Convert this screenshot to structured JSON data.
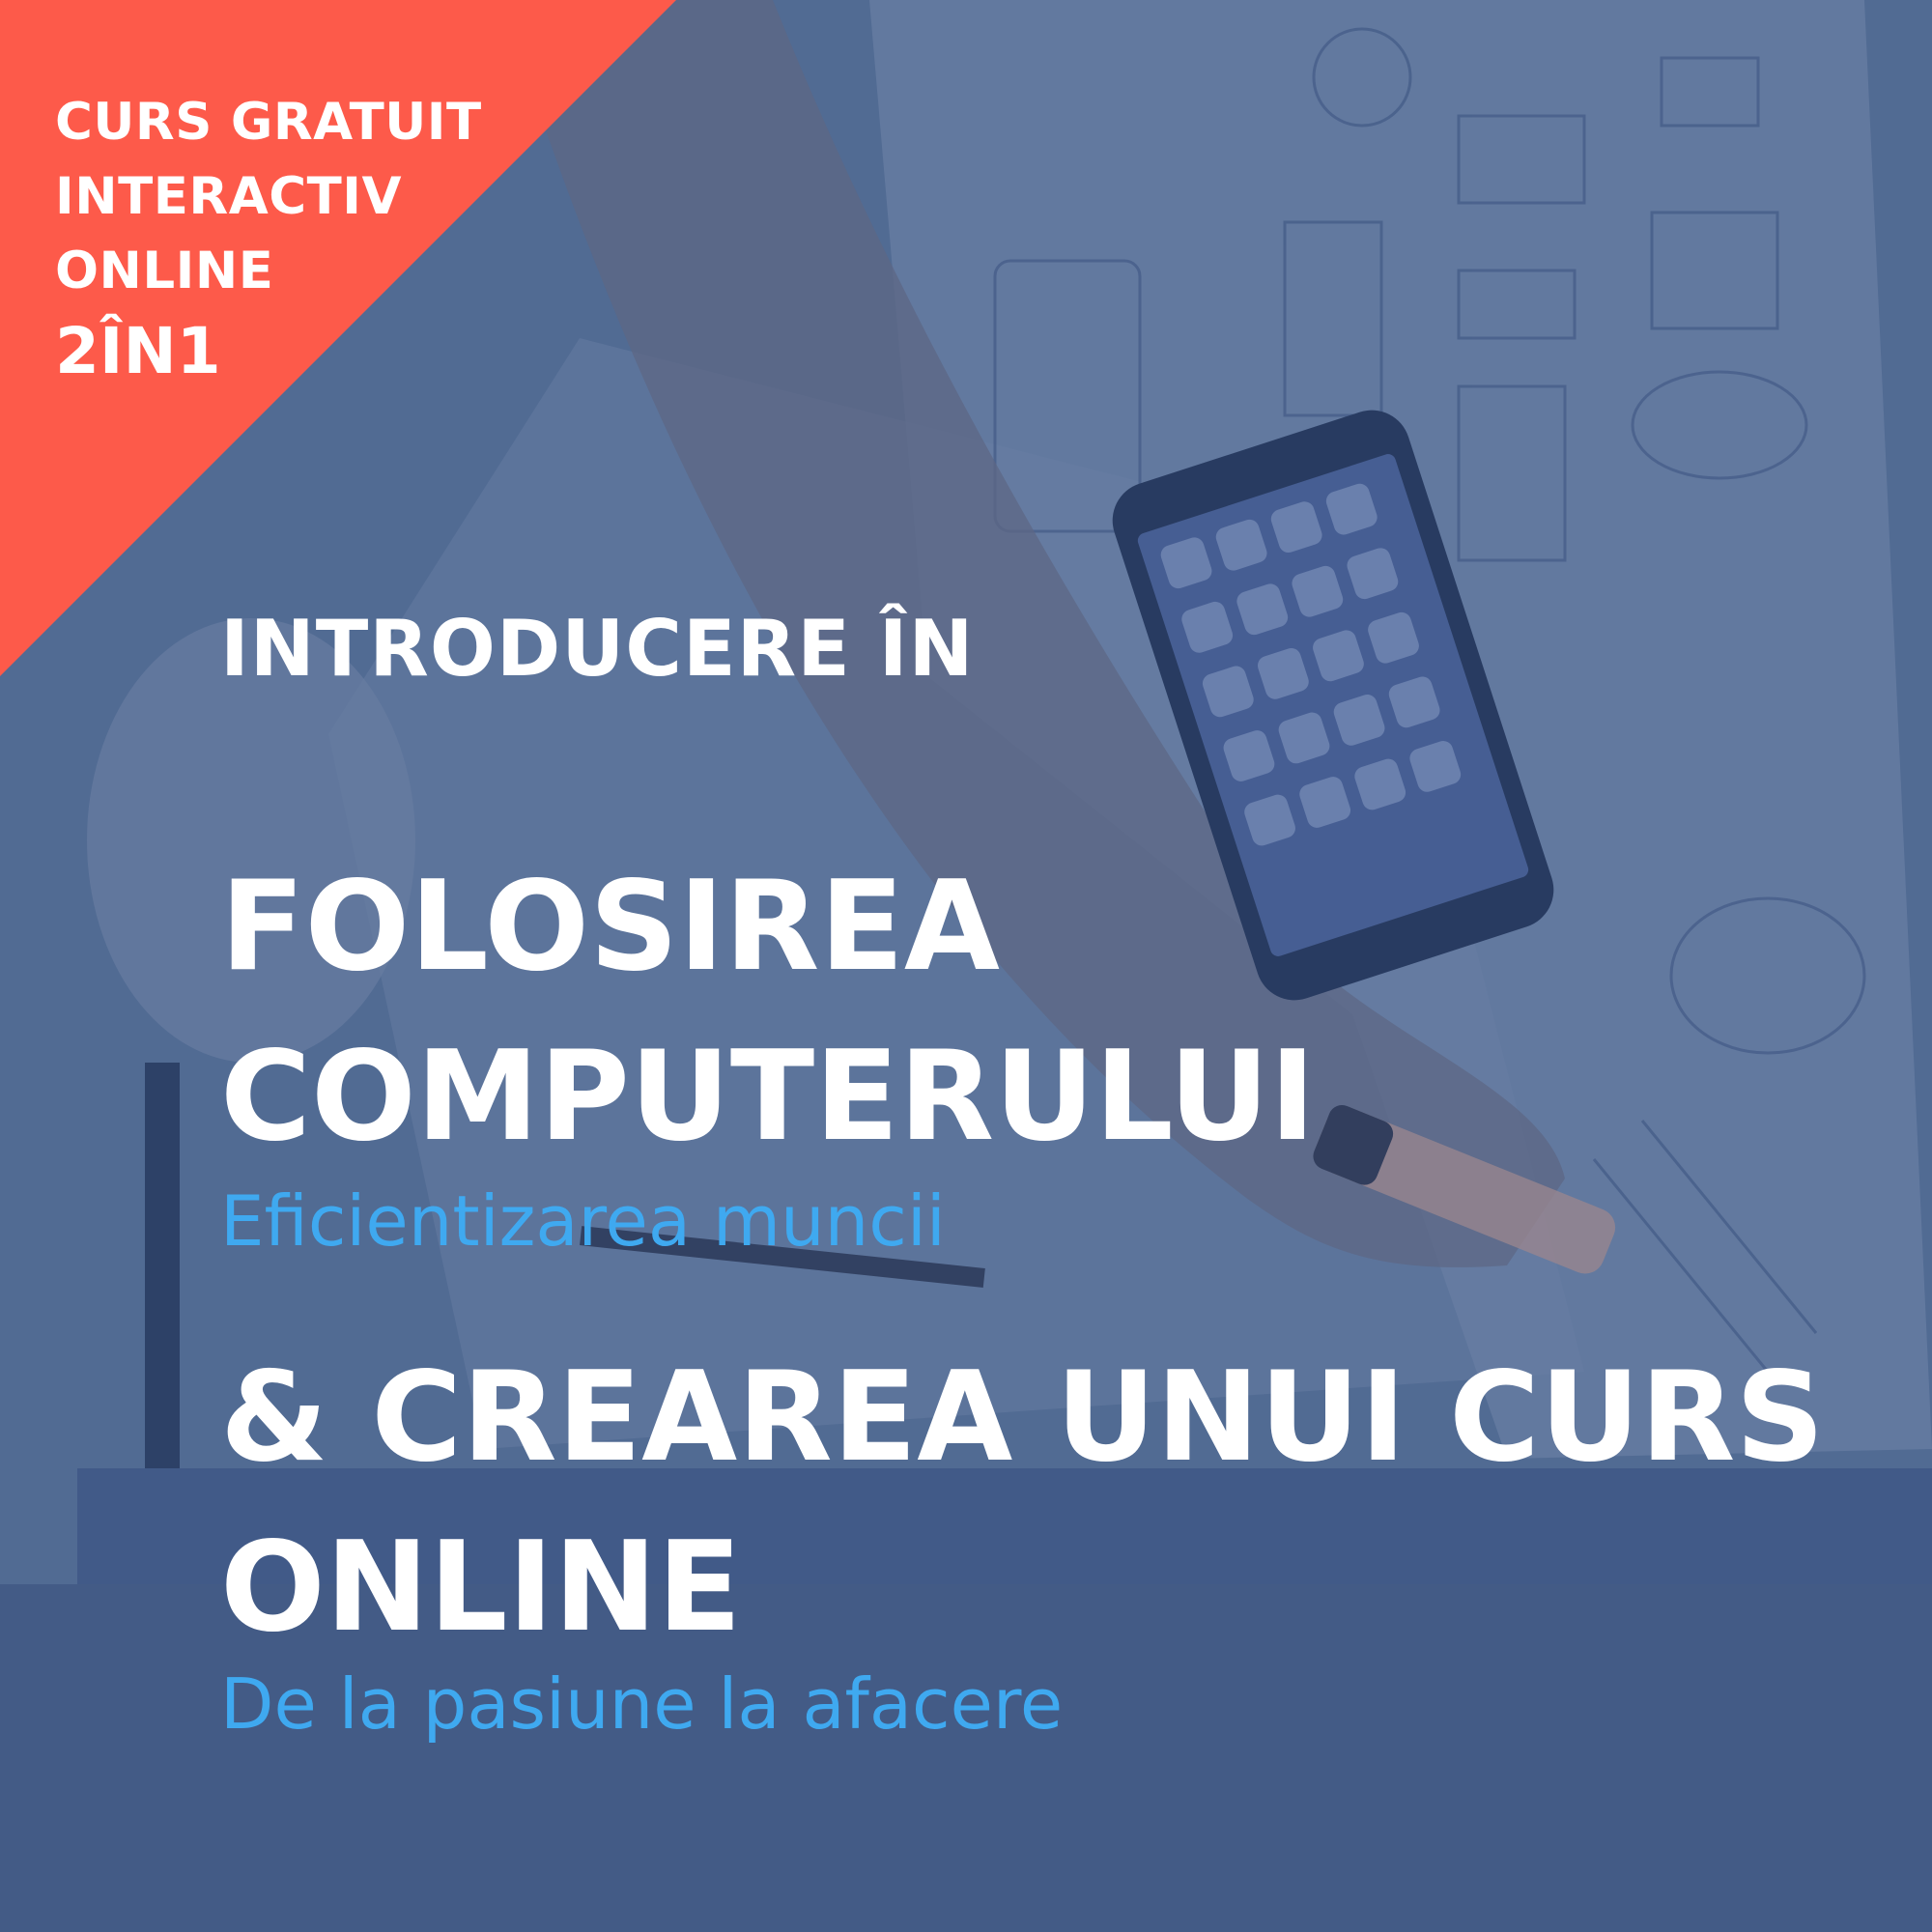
{
  "badge": {
    "line1": "CURS GRATUIT",
    "line2": "INTERACTIV",
    "line3": "ONLINE",
    "line4": "2ÎN1"
  },
  "main": {
    "intro": "INTRODUCERE ÎN",
    "title1_line1": "FOLOSIREA",
    "title1_line2": "COMPUTERULUI",
    "subtitle1": "Eficientizarea muncii",
    "title2_line1": "& CREAREA UNUI CURS",
    "title2_line2": "ONLINE",
    "subtitle2": "De la pasiune la afacere"
  },
  "colors": {
    "badge_bg": "#fd5a4a",
    "overlay": "#3e5c96",
    "accent_text": "#3fa9f0",
    "heading_text": "#ffffff"
  }
}
